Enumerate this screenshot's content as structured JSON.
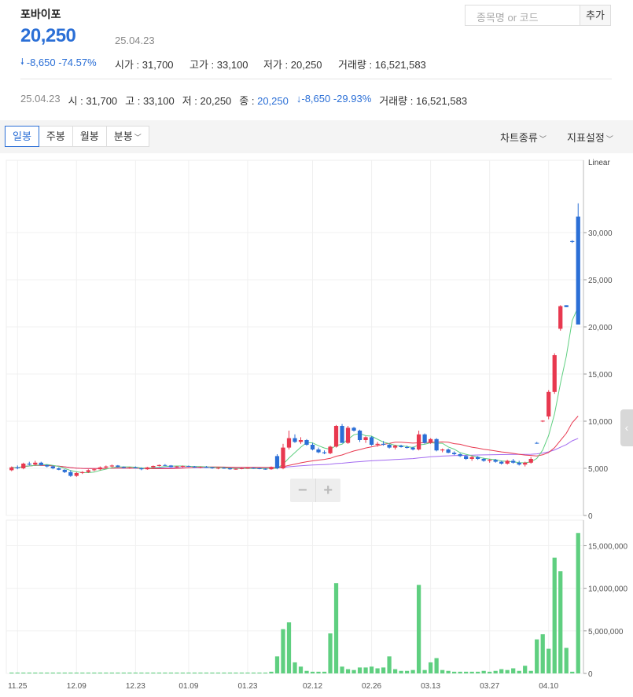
{
  "header": {
    "stock_name": "포바이포",
    "price": "20,250",
    "date": "25.04.23",
    "change_arrow": "🠗",
    "change": "-8,650 -74.57%",
    "ohlc": [
      {
        "label": "시가 : ",
        "value": "31,700"
      },
      {
        "label": "고가 : ",
        "value": "33,100"
      },
      {
        "label": "저가 : ",
        "value": "20,250"
      },
      {
        "label": "거래량 : ",
        "value": "16,521,583"
      }
    ]
  },
  "search": {
    "placeholder": "종목명 or 코드",
    "add_label": "추가"
  },
  "info_line": {
    "date": "25.04.23",
    "open": "시 : 31,700",
    "high": "고 : 33,100",
    "low": "저 : 20,250",
    "close_label": "종 : ",
    "close_value": "20,250",
    "change": "↓-8,650 -29.93%",
    "volume": "거래량 : 16,521,583"
  },
  "toolbar": {
    "tabs": [
      "일봉",
      "주봉",
      "월봉",
      "분봉"
    ],
    "chart_type": "차트종류",
    "indicator": "지표설정"
  },
  "colors": {
    "up": "#e8384f",
    "down": "#2b6fd6",
    "volume": "#5fcf80",
    "ma5": "#5fcf80",
    "ma20": "#e8384f",
    "ma60": "#a36bf0",
    "ma120": "#f0a040"
  },
  "chart_data": {
    "type": "candlestick",
    "scale_label": "Linear",
    "x_ticks": [
      "11.25",
      "12.09",
      "12.23",
      "01.09",
      "01.23",
      "02.12",
      "02.26",
      "03.13",
      "03.27",
      "04.10"
    ],
    "price_ticks": [
      "30,000",
      "25,000",
      "20,000",
      "15,000",
      "10,000",
      "5,000",
      "0"
    ],
    "volume_ticks": [
      "15,000,000",
      "10,000,000",
      "5,000,000",
      "0"
    ],
    "price_ylim": [
      0,
      35500
    ],
    "volume_ylim": [
      0,
      18000000
    ],
    "candles": [
      [
        4800,
        5200,
        4700,
        5100
      ],
      [
        5100,
        5300,
        4900,
        5000
      ],
      [
        5000,
        5600,
        4900,
        5500
      ],
      [
        5500,
        5700,
        5300,
        5400
      ],
      [
        5400,
        5800,
        5300,
        5600
      ],
      [
        5600,
        5700,
        5300,
        5350
      ],
      [
        5350,
        5400,
        5100,
        5200
      ],
      [
        5200,
        5300,
        4900,
        5000
      ],
      [
        5000,
        5100,
        4800,
        4850
      ],
      [
        4850,
        4900,
        4500,
        4600
      ],
      [
        4600,
        4800,
        4100,
        4200
      ],
      [
        4200,
        4600,
        4100,
        4500
      ],
      [
        4500,
        4700,
        4400,
        4600
      ],
      [
        4600,
        4900,
        4500,
        4800
      ],
      [
        4800,
        5000,
        4700,
        4900
      ],
      [
        4900,
        5200,
        4800,
        5100
      ],
      [
        5100,
        5300,
        5000,
        5200
      ],
      [
        5200,
        5400,
        5100,
        5300
      ],
      [
        5300,
        5350,
        5100,
        5150
      ],
      [
        5150,
        5200,
        5000,
        5050
      ],
      [
        5050,
        5150,
        4950,
        5100
      ],
      [
        5100,
        5200,
        5000,
        5000
      ],
      [
        5000,
        5100,
        4800,
        4900
      ],
      [
        4900,
        5150,
        4850,
        5100
      ],
      [
        5100,
        5300,
        5050,
        5250
      ],
      [
        5250,
        5400,
        5200,
        5350
      ],
      [
        5350,
        5450,
        5250,
        5300
      ],
      [
        5300,
        5350,
        5100,
        5150
      ],
      [
        5150,
        5250,
        5050,
        5200
      ],
      [
        5200,
        5300,
        5100,
        5250
      ],
      [
        5250,
        5300,
        5150,
        5200
      ],
      [
        5200,
        5250,
        5050,
        5100
      ],
      [
        5100,
        5200,
        5000,
        5150
      ],
      [
        5150,
        5250,
        5050,
        5100
      ],
      [
        5100,
        5150,
        4950,
        5000
      ],
      [
        5000,
        5100,
        4900,
        5050
      ],
      [
        5050,
        5150,
        4950,
        5000
      ],
      [
        5000,
        5050,
        4850,
        4900
      ],
      [
        4900,
        5000,
        4850,
        4950
      ],
      [
        4950,
        5050,
        4900,
        5000
      ],
      [
        5000,
        5100,
        4950,
        5050
      ],
      [
        5050,
        5100,
        4950,
        5000
      ],
      [
        5000,
        5050,
        4900,
        4950
      ],
      [
        4950,
        5000,
        4850,
        4900
      ],
      [
        4900,
        5200,
        4850,
        5150
      ],
      [
        6300,
        6500,
        4900,
        5000
      ],
      [
        5000,
        7600,
        4900,
        7200
      ],
      [
        7200,
        9000,
        7000,
        8200
      ],
      [
        8200,
        8600,
        7700,
        7800
      ],
      [
        7800,
        8300,
        7600,
        8000
      ],
      [
        8000,
        8100,
        7400,
        7500
      ],
      [
        7500,
        7700,
        6900,
        7000
      ],
      [
        7000,
        7200,
        6600,
        6700
      ],
      [
        6700,
        6900,
        6500,
        6600
      ],
      [
        6600,
        7400,
        6500,
        7300
      ],
      [
        7300,
        9600,
        7200,
        9500
      ],
      [
        9500,
        9700,
        7700,
        7700
      ],
      [
        7700,
        9500,
        7600,
        9300
      ],
      [
        9300,
        9400,
        8900,
        9000
      ],
      [
        9000,
        9100,
        7800,
        8000
      ],
      [
        8000,
        8400,
        7700,
        8300
      ],
      [
        8300,
        8400,
        7400,
        7500
      ],
      [
        7500,
        7800,
        7300,
        7600
      ],
      [
        7600,
        7900,
        7400,
        7500
      ],
      [
        7500,
        7600,
        7100,
        7200
      ],
      [
        7200,
        7500,
        7000,
        7400
      ],
      [
        7400,
        7500,
        7200,
        7250
      ],
      [
        7250,
        7400,
        7100,
        7200
      ],
      [
        7200,
        7300,
        6900,
        7000
      ],
      [
        7000,
        9000,
        6900,
        8600
      ],
      [
        8600,
        8700,
        7600,
        7700
      ],
      [
        7700,
        8200,
        7600,
        8100
      ],
      [
        8100,
        8200,
        6800,
        6900
      ],
      [
        6900,
        7100,
        6700,
        7000
      ],
      [
        7000,
        7100,
        6600,
        6650
      ],
      [
        6650,
        6800,
        6400,
        6500
      ],
      [
        6500,
        6600,
        6200,
        6300
      ],
      [
        6300,
        6400,
        5900,
        6000
      ],
      [
        6000,
        6300,
        5800,
        6200
      ],
      [
        6200,
        6300,
        5900,
        6000
      ],
      [
        6000,
        6100,
        5700,
        5800
      ],
      [
        5800,
        6000,
        5600,
        5900
      ],
      [
        5900,
        6000,
        5600,
        5700
      ],
      [
        5700,
        5800,
        5400,
        5500
      ],
      [
        5500,
        5900,
        5400,
        5800
      ],
      [
        5800,
        6000,
        5500,
        5600
      ],
      [
        5600,
        5800,
        5300,
        5400
      ],
      [
        5400,
        5700,
        5200,
        5600
      ],
      [
        5600,
        6200,
        5500,
        6000
      ],
      [
        7700,
        7800,
        7600,
        7650
      ],
      [
        10000,
        10100,
        9900,
        10050
      ],
      [
        10500,
        13300,
        10200,
        13100
      ],
      [
        13100,
        17200,
        12900,
        17000
      ],
      [
        19800,
        22300,
        19600,
        22200
      ],
      [
        22300,
        22300,
        22100,
        22100
      ],
      [
        29100,
        29200,
        28900,
        29000
      ],
      [
        31700,
        33100,
        20250,
        20250
      ]
    ],
    "volume": [
      0.1,
      0.1,
      0.1,
      0.1,
      0.1,
      0.1,
      0.1,
      0.1,
      0.1,
      0.1,
      0.1,
      0.1,
      0.1,
      0.1,
      0.1,
      0.1,
      0.1,
      0.1,
      0.1,
      0.1,
      0.1,
      0.1,
      0.1,
      0.1,
      0.1,
      0.1,
      0.1,
      0.1,
      0.1,
      0.1,
      0.1,
      0.1,
      0.1,
      0.1,
      0.1,
      0.1,
      0.1,
      0.1,
      0.1,
      0.1,
      0.1,
      0.1,
      0.1,
      0.1,
      0.2,
      2.0,
      5.2,
      6.0,
      1.3,
      0.8,
      0.3,
      0.2,
      0.2,
      0.2,
      4.7,
      10.6,
      0.8,
      0.5,
      0.4,
      0.7,
      0.7,
      0.8,
      0.6,
      0.7,
      2.0,
      0.5,
      0.3,
      0.3,
      0.4,
      10.4,
      0.4,
      1.3,
      1.8,
      0.4,
      0.3,
      0.2,
      0.2,
      0.2,
      0.2,
      0.2,
      0.3,
      0.2,
      0.3,
      0.5,
      0.4,
      0.6,
      0.3,
      0.9,
      0.3,
      4.0,
      4.6,
      2.9,
      13.6,
      12.0,
      3.0,
      0.2,
      16.5
    ]
  }
}
